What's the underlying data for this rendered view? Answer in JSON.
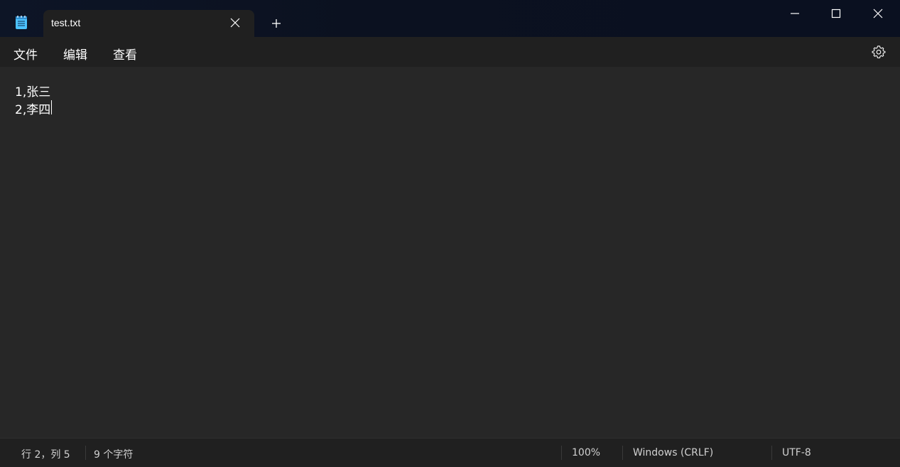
{
  "tab": {
    "title": "test.txt"
  },
  "menu": {
    "file": "文件",
    "edit": "编辑",
    "view": "查看"
  },
  "editor": {
    "lines": [
      "1,张三",
      "2,李四"
    ]
  },
  "status": {
    "position": "行 2，列 5",
    "char_count": "9 个字符",
    "zoom": "100%",
    "line_ending": "Windows (CRLF)",
    "encoding": "UTF-8"
  },
  "icons": {
    "app": "notepad-icon",
    "tab_close": "close-icon",
    "new_tab": "plus-icon",
    "minimize": "minimize-icon",
    "maximize": "maximize-icon",
    "close": "close-window-icon",
    "settings": "gear-icon"
  },
  "colors": {
    "accent": "#4cc2ff",
    "text": "#ffffff",
    "status_text": "#d0d0d0"
  }
}
